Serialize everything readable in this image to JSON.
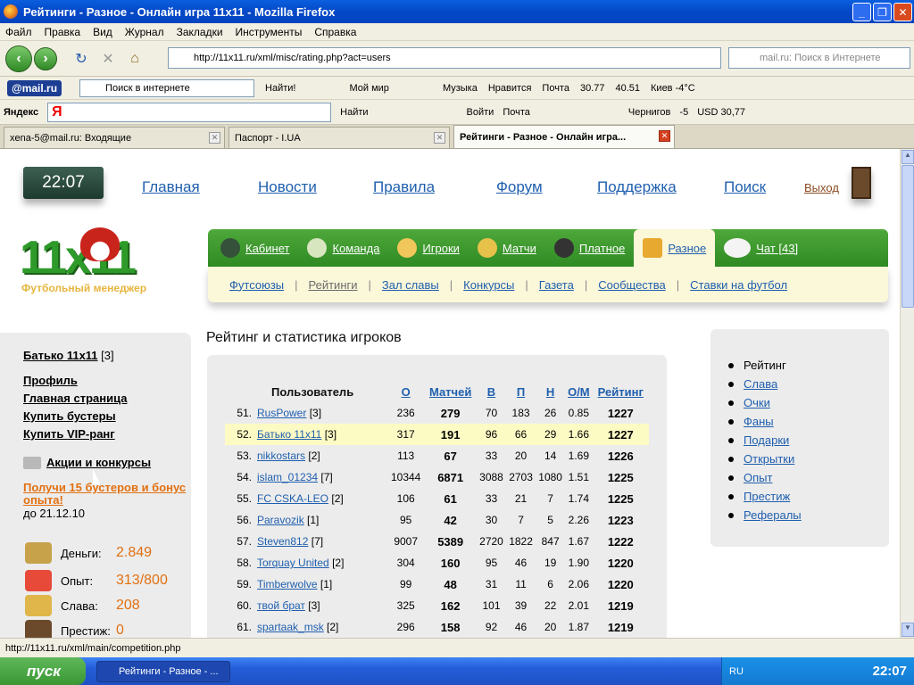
{
  "window": {
    "title": "Рейтинги - Разное - Онлайн игра 11x11 - Mozilla Firefox"
  },
  "menu": [
    "Файл",
    "Правка",
    "Вид",
    "Журнал",
    "Закладки",
    "Инструменты",
    "Справка"
  ],
  "nav": {
    "url": "http://11x11.ru/xml/misc/rating.php?act=users",
    "search_placeholder": "mail.ru: Поиск в Интернете"
  },
  "mailbar": {
    "logo": "@mail.ru",
    "search": "Поиск в интернете",
    "find": "Найти!",
    "items": [
      "Мой мир",
      "Музыка",
      "Нравится",
      "Почта",
      "30.77",
      "40.51",
      "Киев -4°C"
    ]
  },
  "yabar": {
    "label": "Яндекс",
    "input": "Я",
    "find": "Найти",
    "items": [
      "Войти",
      "Почта",
      "Чернигов",
      "-5",
      "USD 30,77"
    ]
  },
  "tabs": [
    {
      "label": "xena-5@mail.ru: Входящие"
    },
    {
      "label": "Паспорт - I.UA"
    },
    {
      "label": "Рейтинги - Разное - Онлайн игра..."
    }
  ],
  "page": {
    "clock": "22:07",
    "topnav": [
      "Главная",
      "Новости",
      "Правила",
      "Форум",
      "Поддержка",
      "Поиск"
    ],
    "exit": "Выход",
    "logo": "11x11",
    "logo_sub": "Футбольный менеджер",
    "green": [
      "Кабинет",
      "Команда",
      "Игроки",
      "Матчи",
      "Платное",
      "Разное",
      "Чат [43]"
    ],
    "sub": [
      "Футсоюзы",
      "Рейтинги",
      "Зал славы",
      "Конкурсы",
      "Газета",
      "Сообщества",
      "Ставки на футбол"
    ],
    "left": {
      "user": "Батько 11x11",
      "user_level": "[3]",
      "links": [
        "Профиль",
        "Главная страница",
        "Купить бустеры",
        "Купить VIP-ранг"
      ],
      "promo": "Акции и конкурсы",
      "offer": "Получи 15 бустеров и бонус опыта!",
      "offer_date": "до 21.12.10",
      "stats": [
        {
          "label": "Деньги:",
          "value": "2.849"
        },
        {
          "label": "Опыт:",
          "value": "313/800"
        },
        {
          "label": "Слава:",
          "value": "208"
        },
        {
          "label": "Престиж:",
          "value": "0"
        }
      ]
    },
    "title": "Рейтинг и статистика игроков",
    "table": {
      "headers": [
        "Пользователь",
        "О",
        "Матчей",
        "В",
        "П",
        "Н",
        "О/М",
        "Рейтинг"
      ],
      "rows": [
        [
          "51.",
          "RusPower",
          "[3]",
          "236",
          "279",
          "70",
          "183",
          "26",
          "0.85",
          "1227"
        ],
        [
          "52.",
          "Батько 11x11",
          "[3]",
          "317",
          "191",
          "96",
          "66",
          "29",
          "1.66",
          "1227"
        ],
        [
          "53.",
          "nikkostars",
          "[2]",
          "113",
          "67",
          "33",
          "20",
          "14",
          "1.69",
          "1226"
        ],
        [
          "54.",
          "islam_01234",
          "[7]",
          "10344",
          "6871",
          "3088",
          "2703",
          "1080",
          "1.51",
          "1225"
        ],
        [
          "55.",
          "FC CSKA-LEO",
          "[2]",
          "106",
          "61",
          "33",
          "21",
          "7",
          "1.74",
          "1225"
        ],
        [
          "56.",
          "Paravozik",
          "[1]",
          "95",
          "42",
          "30",
          "7",
          "5",
          "2.26",
          "1223"
        ],
        [
          "57.",
          "Steven812",
          "[7]",
          "9007",
          "5389",
          "2720",
          "1822",
          "847",
          "1.67",
          "1222"
        ],
        [
          "58.",
          "Torquay United",
          "[2]",
          "304",
          "160",
          "95",
          "46",
          "19",
          "1.90",
          "1220"
        ],
        [
          "59.",
          "Timberwolve",
          "[1]",
          "99",
          "48",
          "31",
          "11",
          "6",
          "2.06",
          "1220"
        ],
        [
          "60.",
          "твой брат",
          "[3]",
          "325",
          "162",
          "101",
          "39",
          "22",
          "2.01",
          "1219"
        ],
        [
          "61.",
          "spartaak_msk",
          "[2]",
          "296",
          "158",
          "92",
          "46",
          "20",
          "1.87",
          "1219"
        ]
      ]
    },
    "right": [
      "Рейтинг",
      "Слава",
      "Очки",
      "Фаны",
      "Подарки",
      "Открытки",
      "Опыт",
      "Престиж",
      "Рефералы"
    ]
  },
  "status": "http://11x11.ru/xml/main/competition.php",
  "taskbar": {
    "start": "пуск",
    "item": "Рейтинги - Разное - ...",
    "lang": "RU",
    "clock": "22:07"
  }
}
